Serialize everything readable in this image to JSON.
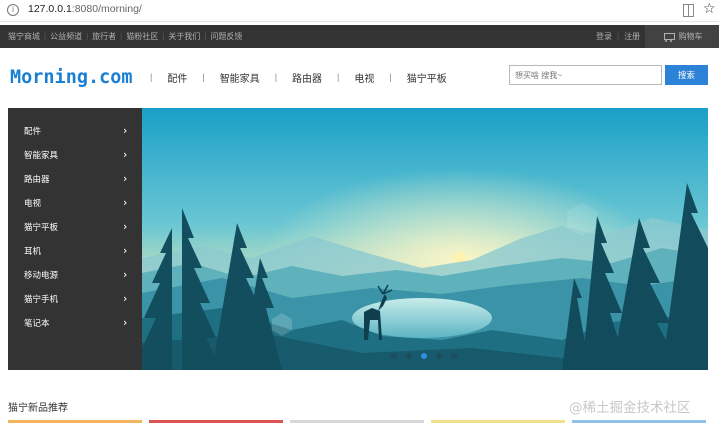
{
  "browser": {
    "url_host": "127.0.0.1",
    "url_rest": ":8080/morning/"
  },
  "topbar": {
    "links": [
      "猫宁商城",
      "公益频道",
      "旅行者",
      "猫粉社区",
      "关于我们",
      "问题反馈"
    ],
    "login": "登录",
    "register": "注册",
    "cart": "购物车"
  },
  "header": {
    "logo": "Morning.com",
    "nav": [
      "配件",
      "智能家具",
      "路由器",
      "电视",
      "猫宁平板"
    ],
    "search_placeholder": "想买啥 搜我~",
    "search_button": "搜索"
  },
  "sidebar": {
    "items": [
      "配件",
      "智能家具",
      "路由器",
      "电视",
      "猫宁平板",
      "耳机",
      "移动电源",
      "猫宁手机",
      "笔记本"
    ]
  },
  "carousel": {
    "slide_count": 5,
    "active_index": 2
  },
  "section": {
    "title": "猫宁新品推荐"
  },
  "watermark": "@稀土掘金技术社区",
  "colors": {
    "accent": "#2b82d6",
    "topbar_bg": "#333333",
    "sidebar_bg": "#333333"
  }
}
